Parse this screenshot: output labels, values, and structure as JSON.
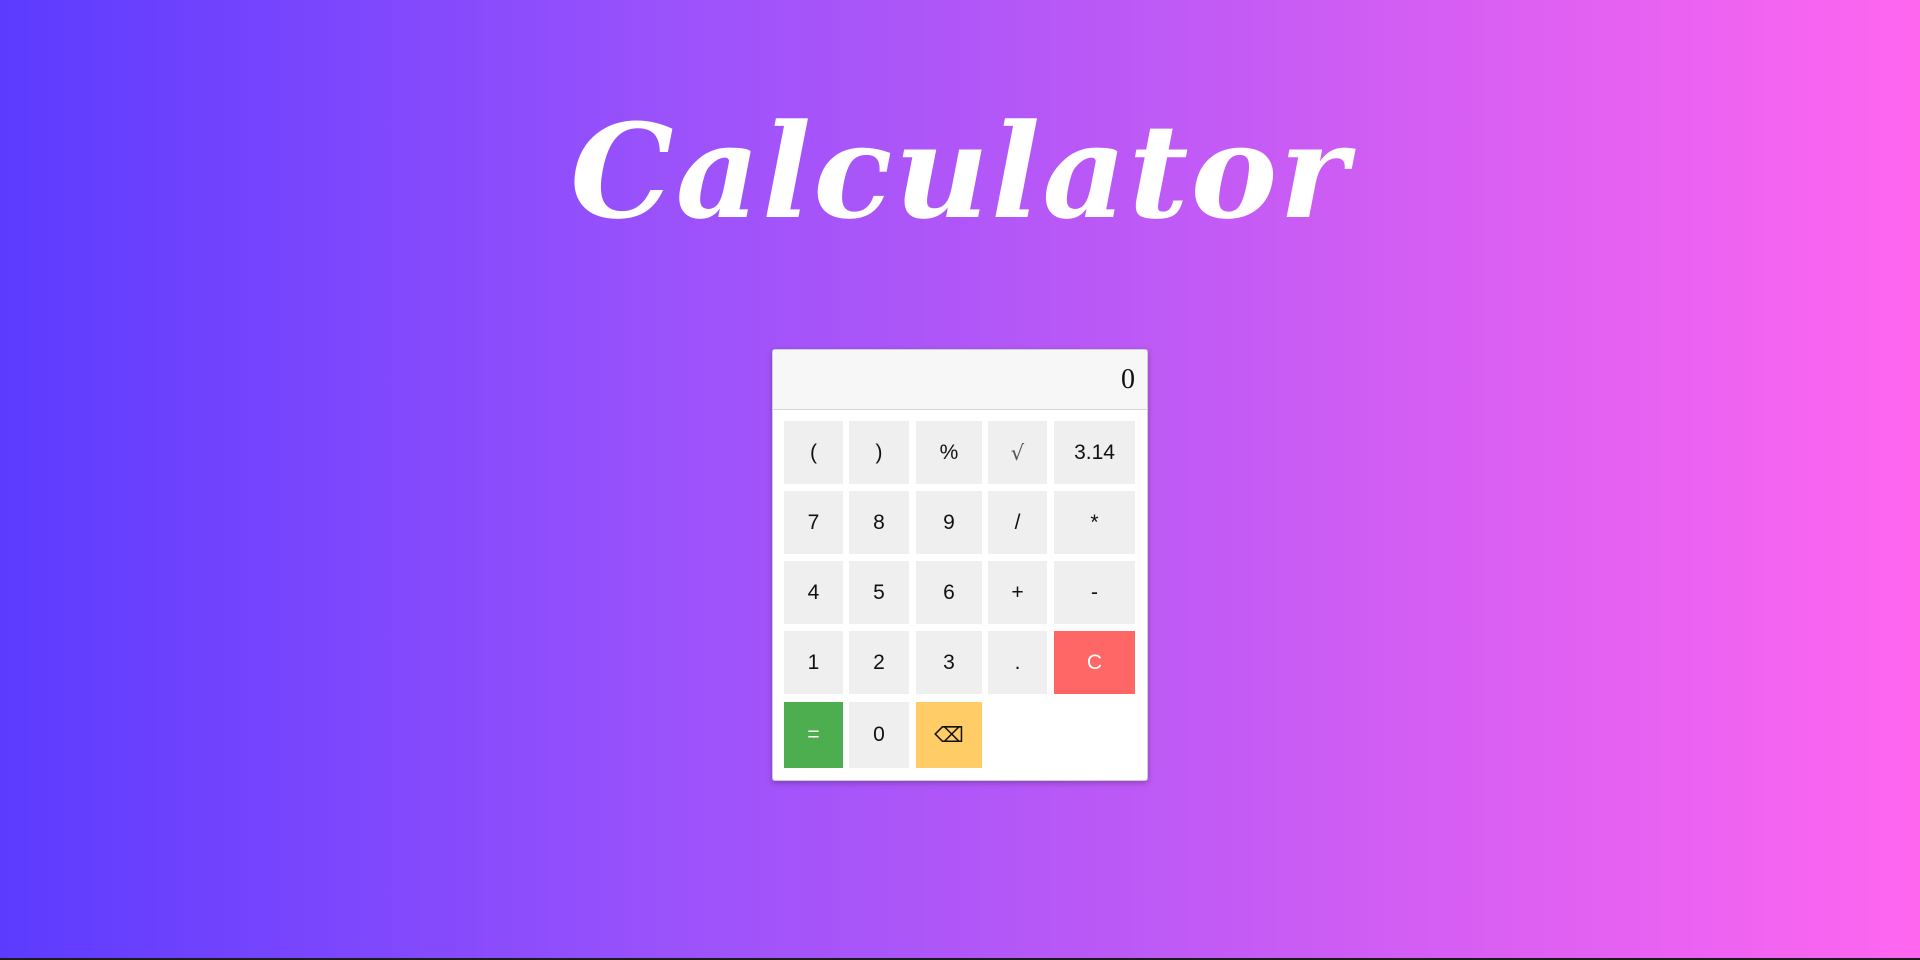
{
  "page": {
    "title": "Calculator"
  },
  "calculator": {
    "display_value": "0",
    "keys": {
      "open_paren": "(",
      "close_paren": ")",
      "percent": "%",
      "sqrt": "√",
      "pi": "3.14",
      "seven": "7",
      "eight": "8",
      "nine": "9",
      "divide": "/",
      "multiply": "*",
      "four": "4",
      "five": "5",
      "six": "6",
      "plus": "+",
      "minus": "-",
      "one": "1",
      "two": "2",
      "three": "3",
      "decimal": ".",
      "clear": "C",
      "equals": "=",
      "zero": "0",
      "backspace": "⌫"
    }
  },
  "colors": {
    "gradient_start": "#5c3bff",
    "gradient_end": "#ff66f0",
    "equals_key": "#4cae4f",
    "clear_key": "#ff6666",
    "backspace_key": "#ffcc66",
    "key_default": "#efefef"
  }
}
